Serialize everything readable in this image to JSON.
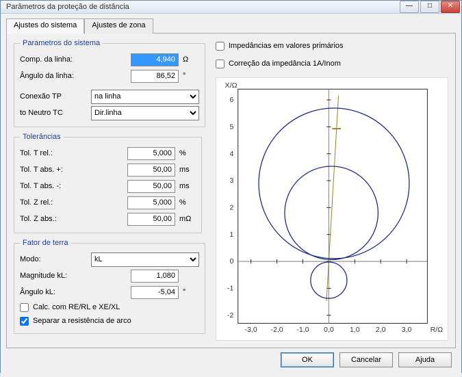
{
  "window": {
    "title": "Parâmetros da proteção de distância"
  },
  "tabs": {
    "active": "Ajustes do sistema",
    "zone": "Ajustes de zona"
  },
  "groups": {
    "system": {
      "legend": "Parametros do sistema",
      "comp_label": "Comp. da linha:",
      "comp_value": "4,940",
      "comp_unit": "Ω",
      "angle_label": "Ângulo da linha:",
      "angle_value": "86,52",
      "angle_unit": "°",
      "tp_label": "Conexão TP",
      "tp_value": "na linha",
      "tc_label": "to Neutro TC",
      "tc_value": "Dir.linha"
    },
    "tolerances": {
      "legend": "Tolerâncias",
      "trel_label": "Tol. T rel.:",
      "trel_value": "5,000",
      "trel_unit": "%",
      "tabsplus_label": "Tol. T abs. +:",
      "tabsplus_value": "50,00",
      "tabsplus_unit": "ms",
      "tabsminus_label": "Tol. T abs. -:",
      "tabsminus_value": "50,00",
      "tabsminus_unit": "ms",
      "zrel_label": "Tol. Z rel.:",
      "zrel_value": "5,000",
      "zrel_unit": "%",
      "zabs_label": "Tol. Z abs.:",
      "zabs_value": "50,00",
      "zabs_unit": "mΩ"
    },
    "ground": {
      "legend": "Fator de terra",
      "mode_label": "Modo:",
      "mode_value": "kL",
      "mag_label": "Magnitude kL:",
      "mag_value": "1,080",
      "ang_label": "Ângulo kL:",
      "ang_value": "-5,04",
      "ang_unit": "°",
      "cb1_label": "Calc. com RE/RL e XE/XL",
      "cb2_label": "Separar a resistência de arco"
    }
  },
  "right": {
    "cb_primary": "Impedâncias em valores primários",
    "cb_corr": "Correção da impedância 1A/Inom",
    "ylabel": "X/Ω",
    "xlabel": "R/Ω"
  },
  "buttons": {
    "ok": "OK",
    "cancel": "Cancelar",
    "help": "Ajuda"
  },
  "chart_data": {
    "type": "impedance-mho",
    "xlabel": "R/Ω",
    "ylabel": "X/Ω",
    "xlim": [
      -3.5,
      3.8
    ],
    "ylim": [
      -2.3,
      6.4
    ],
    "xticks": [
      -3.0,
      -2.0,
      -1.0,
      0.0,
      1.0,
      2.0,
      3.0
    ],
    "yticks": [
      -2,
      -1,
      0,
      1,
      2,
      3,
      4,
      5,
      6
    ],
    "line_angle_deg": 86.52,
    "line_length": 4.94,
    "zones": [
      {
        "name": "z1",
        "center_r": 0.0,
        "center_x": -0.7,
        "radius": 0.7
      },
      {
        "name": "z2",
        "center_r": 0.1,
        "center_x": 1.8,
        "radius": 1.8
      },
      {
        "name": "z3",
        "center_r": 0.2,
        "center_x": 2.9,
        "radius": 2.9
      }
    ]
  }
}
